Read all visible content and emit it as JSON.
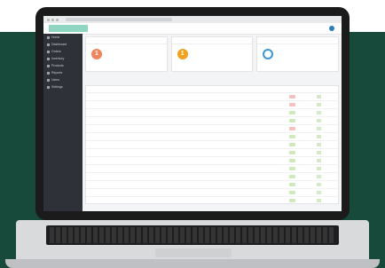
{
  "browser": {
    "url_bar": ""
  },
  "app": {
    "logo_text": "",
    "user_label": ""
  },
  "sidebar": {
    "items": [
      {
        "label": "Home"
      },
      {
        "label": "Dashboard"
      },
      {
        "label": "Orders"
      },
      {
        "label": "Inventory"
      },
      {
        "label": "Products"
      },
      {
        "label": "Reports"
      },
      {
        "label": "Users"
      },
      {
        "label": "Settings"
      }
    ]
  },
  "cards": [
    {
      "title": "",
      "count": "1",
      "label": ""
    },
    {
      "title": "",
      "count": "1",
      "label": ""
    },
    {
      "title": "",
      "count": "",
      "label": ""
    }
  ],
  "toolbar": {
    "left": "",
    "right": ""
  },
  "table": {
    "headers": [
      "",
      "",
      "",
      "",
      ""
    ],
    "rows": [
      {
        "name": "",
        "qty": "",
        "desc": ""
      },
      {
        "name": "",
        "qty": "",
        "desc": ""
      },
      {
        "name": "",
        "qty": "",
        "desc": ""
      },
      {
        "name": "",
        "qty": "",
        "desc": ""
      },
      {
        "name": "",
        "qty": "",
        "desc": ""
      },
      {
        "name": "",
        "qty": "",
        "desc": ""
      },
      {
        "name": "",
        "qty": "",
        "desc": ""
      },
      {
        "name": "",
        "qty": "",
        "desc": ""
      },
      {
        "name": "",
        "qty": "",
        "desc": ""
      },
      {
        "name": "",
        "qty": "",
        "desc": ""
      },
      {
        "name": "",
        "qty": "",
        "desc": ""
      },
      {
        "name": "",
        "qty": "",
        "desc": ""
      },
      {
        "name": "",
        "qty": "",
        "desc": ""
      },
      {
        "name": "",
        "qty": "",
        "desc": ""
      },
      {
        "name": "",
        "qty": "",
        "desc": ""
      },
      {
        "name": "",
        "qty": "",
        "desc": ""
      }
    ]
  },
  "colors": {
    "background": "#174a3a",
    "accent": "#3a96d6",
    "warning": "#f0a21c",
    "orange": "#f0845d"
  }
}
